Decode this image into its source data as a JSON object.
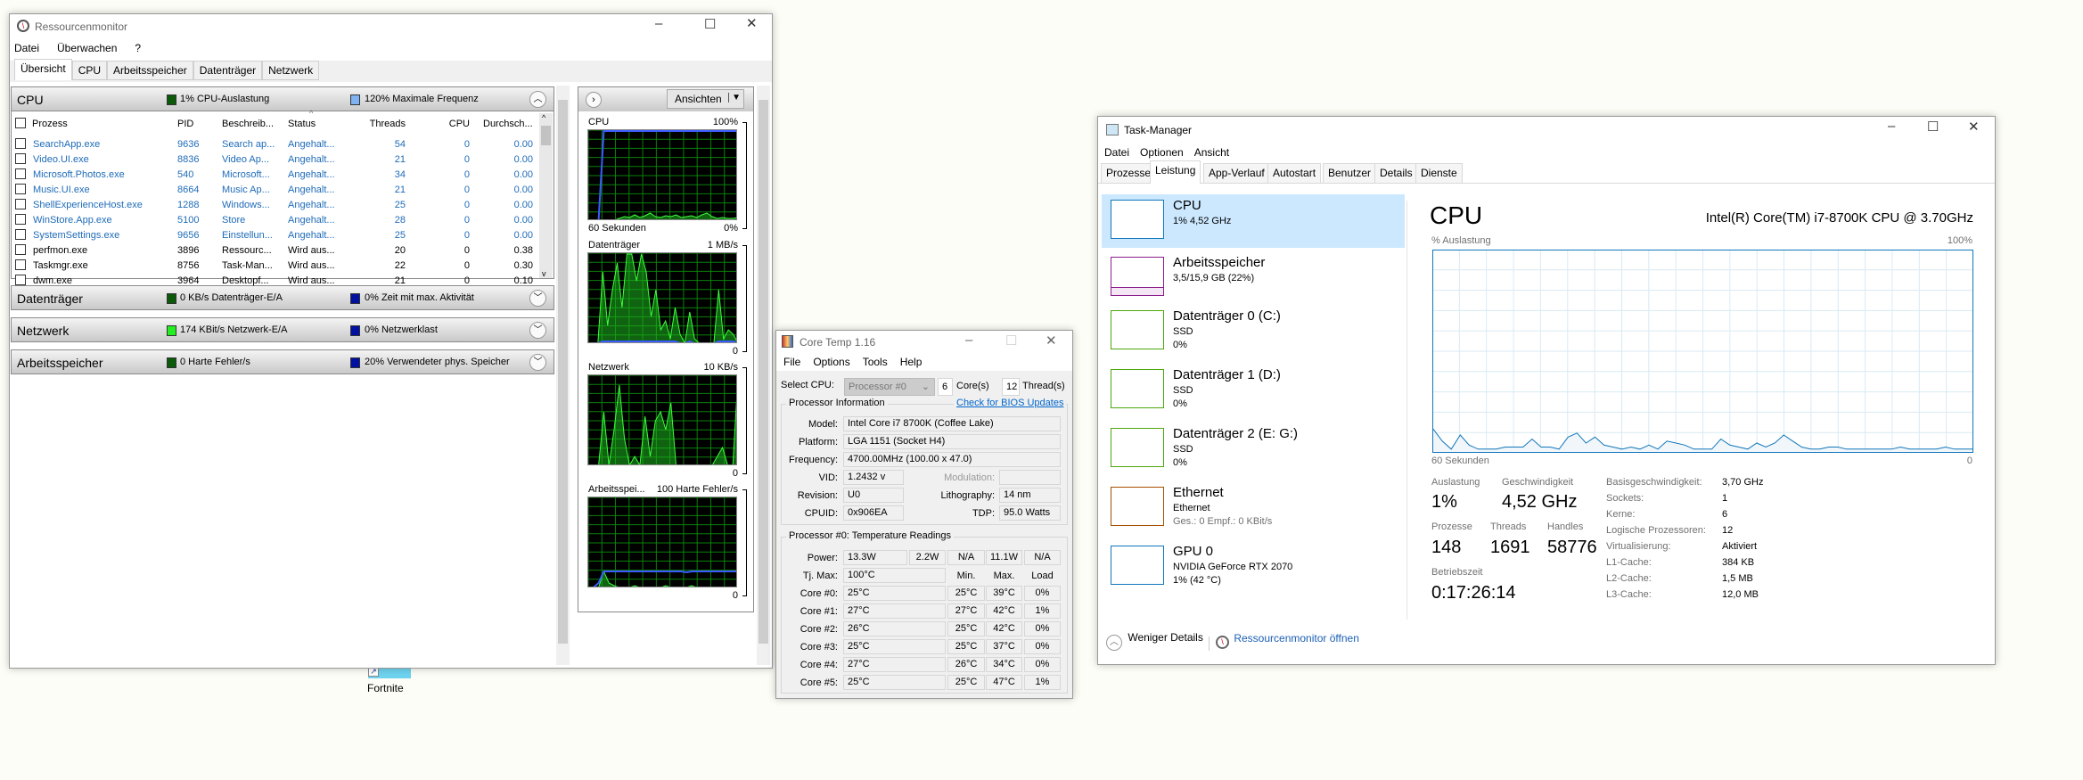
{
  "resmon": {
    "title": "Ressourcenmonitor",
    "menu": [
      "Datei",
      "Überwachen",
      "?"
    ],
    "tabs": [
      "Übersicht",
      "CPU",
      "Arbeitsspeicher",
      "Datenträger",
      "Netzwerk"
    ],
    "cpu_section": {
      "title": "CPU",
      "legend1": "1% CPU-Auslastung",
      "legend1_color": "#0a5a0a",
      "legend2": "120% Maximale Frequenz",
      "legend2_color": "#7fb2f0"
    },
    "columns": [
      "Prozess",
      "PID",
      "Beschreib...",
      "Status",
      "Threads",
      "CPU",
      "Durchsch..."
    ],
    "rows": [
      [
        "SearchApp.exe",
        "9636",
        "Search ap...",
        "Angehalt...",
        "54",
        "0",
        "0.00",
        true
      ],
      [
        "Video.UI.exe",
        "8836",
        "Video Ap...",
        "Angehalt...",
        "21",
        "0",
        "0.00",
        true
      ],
      [
        "Microsoft.Photos.exe",
        "540",
        "Microsoft...",
        "Angehalt...",
        "34",
        "0",
        "0.00",
        true
      ],
      [
        "Music.UI.exe",
        "8664",
        "Music Ap...",
        "Angehalt...",
        "21",
        "0",
        "0.00",
        true
      ],
      [
        "ShellExperienceHost.exe",
        "1288",
        "Windows...",
        "Angehalt...",
        "25",
        "0",
        "0.00",
        true
      ],
      [
        "WinStore.App.exe",
        "5100",
        "Store",
        "Angehalt...",
        "28",
        "0",
        "0.00",
        true
      ],
      [
        "SystemSettings.exe",
        "9656",
        "Einstellun...",
        "Angehalt...",
        "25",
        "0",
        "0.00",
        true
      ],
      [
        "perfmon.exe",
        "3896",
        "Ressourc...",
        "Wird aus...",
        "20",
        "0",
        "0.38",
        false
      ],
      [
        "Taskmgr.exe",
        "8756",
        "Task-Man...",
        "Wird aus...",
        "22",
        "0",
        "0.30",
        false
      ],
      [
        "dwm.exe",
        "3964",
        "Desktopf...",
        "Wird aus...",
        "21",
        "0",
        "0.10",
        false
      ]
    ],
    "sections": [
      {
        "title": "Datenträger",
        "legend1": "0 KB/s Datenträger-E/A",
        "c1": "#0a5a0a",
        "legend2": "0% Zeit mit max. Aktivität",
        "c2": "#0010a0"
      },
      {
        "title": "Netzwerk",
        "legend1": "174 KBit/s Netzwerk-E/A",
        "c1": "#22ee22",
        "legend2": "0% Netzwerklast",
        "c2": "#0010a0"
      },
      {
        "title": "Arbeitsspeicher",
        "legend1": "0 Harte Fehler/s",
        "c1": "#0a5a0a",
        "legend2": "20% Verwendeter phys. Speicher",
        "c2": "#0010a0"
      }
    ],
    "views_button": "Ansichten",
    "graphs": [
      {
        "label": "CPU",
        "max": "100%",
        "min": "0%",
        "sub": "60 Sekunden",
        "green": [
          0,
          0,
          0,
          0,
          0,
          0,
          2,
          4,
          3,
          6,
          3,
          5,
          8,
          4,
          3,
          5,
          4,
          6,
          3,
          4,
          5,
          3,
          6,
          8,
          4,
          2,
          3,
          2,
          2,
          3
        ],
        "blue": [
          0,
          0,
          0,
          100,
          100,
          100,
          100,
          100,
          100,
          100,
          100,
          100,
          100,
          100,
          100,
          100,
          100,
          100,
          100,
          100,
          100,
          100,
          100,
          100,
          100,
          100,
          100,
          100,
          100,
          100
        ]
      },
      {
        "label": "Datenträger",
        "max": "1 MB/s",
        "min": "0",
        "green": [
          0,
          0,
          0,
          80,
          20,
          60,
          90,
          40,
          100,
          100,
          70,
          100,
          80,
          30,
          60,
          15,
          25,
          5,
          40,
          10,
          0,
          35,
          5,
          0,
          0,
          0,
          0,
          60,
          5,
          15,
          10,
          0
        ],
        "blue": [
          0,
          0,
          0,
          2,
          2,
          2,
          2,
          2,
          2,
          2,
          2,
          2,
          2,
          2,
          2,
          2,
          2,
          2,
          2,
          0,
          0,
          2,
          0,
          0,
          0,
          0,
          0,
          2,
          2,
          2,
          2,
          0
        ]
      },
      {
        "label": "Netzwerk",
        "max": "10 KB/s",
        "min": "0",
        "green": [
          0,
          0,
          0,
          60,
          0,
          40,
          90,
          30,
          0,
          10,
          0,
          55,
          10,
          50,
          60,
          40,
          70,
          0,
          0,
          0,
          0,
          0,
          0,
          0,
          0,
          10,
          20,
          0,
          0,
          100
        ],
        "blue": []
      },
      {
        "label": "Arbeitsspei...",
        "max": "100 Harte Fehler/s",
        "min": "0",
        "green": [
          0,
          0,
          0,
          18,
          5,
          2,
          0,
          0,
          0,
          2,
          0,
          0,
          0,
          0,
          0,
          2,
          0,
          0,
          0,
          0,
          2,
          0,
          0,
          0,
          0,
          0,
          0,
          0,
          0,
          0
        ],
        "blue": [
          0,
          0,
          5,
          18,
          18,
          18,
          18,
          18,
          18,
          18,
          18,
          18,
          18,
          18,
          18,
          18,
          18,
          18,
          18,
          17,
          18,
          18,
          18,
          18,
          18,
          18,
          18,
          18,
          18,
          18
        ]
      }
    ]
  },
  "coretemp": {
    "title": "Core Temp 1.16",
    "menu": [
      "File",
      "Options",
      "Tools",
      "Help"
    ],
    "select_cpu_label": "Select CPU:",
    "processor": "Processor #0",
    "cores": "6",
    "cores_label": "Core(s)",
    "threads": "12",
    "threads_label": "Thread(s)",
    "proc_info": "Processor Information",
    "bios_link": "Check for BIOS Updates",
    "model_label": "Model:",
    "model": "Intel Core i7 8700K (Coffee Lake)",
    "platform_label": "Platform:",
    "platform": "LGA 1151 (Socket H4)",
    "frequency_label": "Frequency:",
    "frequency": "4700.00MHz (100.00 x 47.0)",
    "vid_label": "VID:",
    "vid": "1.2432 v",
    "modulation_label": "Modulation:",
    "modulation": "",
    "revision_label": "Revision:",
    "revision": "U0",
    "lithography_label": "Lithography:",
    "lithography": "14 nm",
    "cpuid_label": "CPUID:",
    "cpuid": "0x906EA",
    "tdp_label": "TDP:",
    "tdp": "95.0 Watts",
    "temp_title": "Processor #0: Temperature Readings",
    "power_label": "Power:",
    "power": [
      "13.3W",
      "2.2W",
      "N/A",
      "11.1W",
      "N/A"
    ],
    "tj_label": "Tj. Max:",
    "tj": "100°C",
    "min_h": "Min.",
    "max_h": "Max.",
    "load_h": "Load",
    "cores_rows": [
      [
        "Core #0:",
        "25°C",
        "25°C",
        "39°C",
        "0%"
      ],
      [
        "Core #1:",
        "27°C",
        "27°C",
        "42°C",
        "1%"
      ],
      [
        "Core #2:",
        "26°C",
        "25°C",
        "42°C",
        "0%"
      ],
      [
        "Core #3:",
        "25°C",
        "25°C",
        "37°C",
        "0%"
      ],
      [
        "Core #4:",
        "27°C",
        "26°C",
        "34°C",
        "0%"
      ],
      [
        "Core #5:",
        "25°C",
        "25°C",
        "47°C",
        "1%"
      ]
    ]
  },
  "taskmgr": {
    "title": "Task-Manager",
    "menu": [
      "Datei",
      "Optionen",
      "Ansicht"
    ],
    "tabs": [
      "Prozesse",
      "Leistung",
      "App-Verlauf",
      "Autostart",
      "Benutzer",
      "Details",
      "Dienste"
    ],
    "sidebar": [
      {
        "t1": "CPU",
        "t2": "1% 4,52 GHz",
        "t3": "",
        "color": "#1177bb"
      },
      {
        "t1": "Arbeitsspeicher",
        "t2": "3,5/15,9 GB (22%)",
        "t3": "",
        "color": "#8b1e8b",
        "fill": 0.22
      },
      {
        "t1": "Datenträger 0 (C:)",
        "t2": "SSD",
        "t3": "0%",
        "color": "#4da60c"
      },
      {
        "t1": "Datenträger 1 (D:)",
        "t2": "SSD",
        "t3": "0%",
        "color": "#4da60c"
      },
      {
        "t1": "Datenträger 2 (E: G:)",
        "t2": "SSD",
        "t3": "0%",
        "color": "#4da60c"
      },
      {
        "t1": "Ethernet",
        "t2": "Ethernet",
        "t3": "Ges.: 0 Empf.: 0 KBit/s",
        "color": "#a74f01"
      },
      {
        "t1": "GPU 0",
        "t2": "NVIDIA GeForce RTX 2070",
        "t3": "1% (42 °C)",
        "color": "#1177bb"
      }
    ],
    "main_title": "CPU",
    "cpu_name": "Intel(R) Core(TM) i7-8700K CPU @ 3.70GHz",
    "graph_label": "% Auslastung",
    "graph_max": "100%",
    "graph_time": "60 Sekunden",
    "graph_min": "0",
    "cpu_history": [
      11,
      5,
      1,
      8,
      3,
      1,
      1,
      1,
      2,
      2,
      2,
      6,
      2,
      2,
      1,
      7,
      9,
      4,
      7,
      3,
      2,
      1,
      2,
      1,
      3,
      1,
      5,
      4,
      3,
      1,
      1,
      1,
      6,
      3,
      2,
      1,
      4,
      2,
      4,
      8,
      5,
      2,
      1,
      1,
      2,
      2,
      1,
      1,
      1,
      1,
      1,
      1,
      2,
      1,
      1,
      1,
      1,
      2,
      1,
      1,
      1
    ],
    "stats": {
      "auslastung_label": "Auslastung",
      "auslastung": "1%",
      "geschw_label": "Geschwindigkeit",
      "geschw": "4,52 GHz",
      "prozesse_label": "Prozesse",
      "prozesse": "148",
      "threads_label": "Threads",
      "threads": "1691",
      "handles_label": "Handles",
      "handles": "58776",
      "betriebszeit_label": "Betriebszeit",
      "betriebszeit": "0:17:26:14"
    },
    "details": [
      [
        "Basisgeschwindigkeit:",
        "3,70 GHz"
      ],
      [
        "Sockets:",
        "1"
      ],
      [
        "Kerne:",
        "6"
      ],
      [
        "Logische Prozessoren:",
        "12"
      ],
      [
        "Virtualisierung:",
        "Aktiviert"
      ],
      [
        "L1-Cache:",
        "384 KB"
      ],
      [
        "L2-Cache:",
        "1,5 MB"
      ],
      [
        "L3-Cache:",
        "12,0 MB"
      ]
    ],
    "fewer_details": "Weniger Details",
    "open_resmon": "Ressourcenmonitor öffnen"
  },
  "desktop": {
    "icon_label": "Fortnite"
  }
}
